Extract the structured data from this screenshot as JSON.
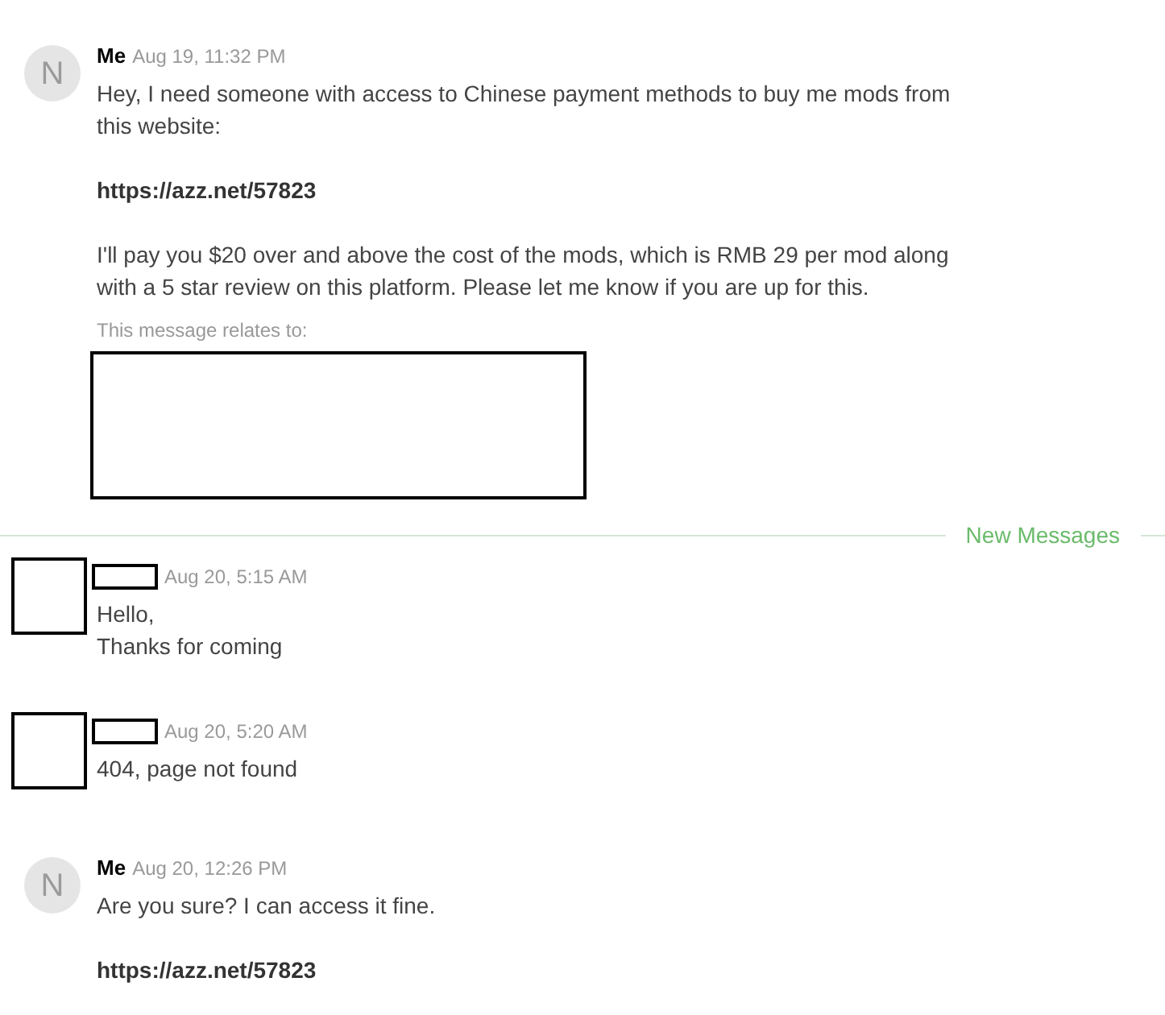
{
  "conversation": [
    {
      "kind": "message",
      "sender": {
        "kind": "named",
        "name": "Me",
        "initial": "N"
      },
      "time": "Aug 19, 11:32 PM",
      "paragraphs": [
        {
          "kind": "text",
          "text": "Hey, I need someone with access to Chinese payment methods to buy me mods from this website:"
        },
        {
          "kind": "link",
          "text": "https://azz.net/57823"
        },
        {
          "kind": "text",
          "text": "I'll pay you $20 over and above the cost of the mods, which is RMB 29 per mod along with a 5 star review on this platform. Please let me know if you are up for this."
        }
      ],
      "relates_to": {
        "label": "This message relates to:"
      }
    },
    {
      "kind": "divider",
      "label": "New Messages"
    },
    {
      "kind": "message",
      "sender": {
        "kind": "redacted"
      },
      "time": "Aug 20, 5:15 AM",
      "paragraphs": [
        {
          "kind": "text",
          "text": "Hello,\nThanks for coming"
        }
      ]
    },
    {
      "kind": "message",
      "sender": {
        "kind": "redacted"
      },
      "time": "Aug 20, 5:20 AM",
      "paragraphs": [
        {
          "kind": "text",
          "text": "404, page not found"
        }
      ]
    },
    {
      "kind": "message",
      "sender": {
        "kind": "named",
        "name": "Me",
        "initial": "N"
      },
      "time": "Aug 20, 12:26 PM",
      "paragraphs": [
        {
          "kind": "text",
          "text": "Are you sure? I can access it fine."
        },
        {
          "kind": "link",
          "text": "https://azz.net/57823"
        }
      ]
    }
  ]
}
